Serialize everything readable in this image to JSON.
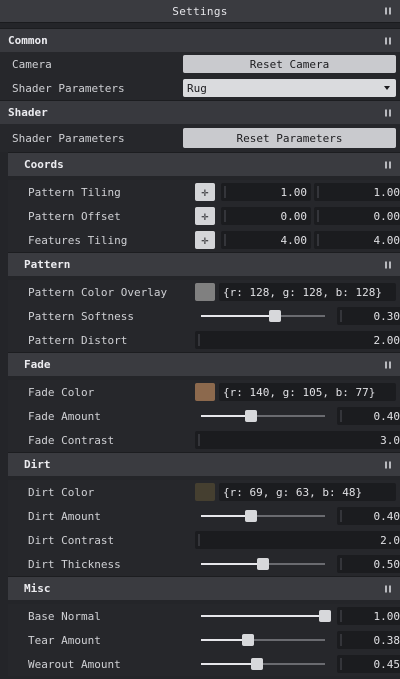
{
  "title": "Settings",
  "common": {
    "header": "Common",
    "camera_label": "Camera",
    "camera_button": "Reset Camera",
    "shader_params_label": "Shader Parameters",
    "shader_params_value": "Rug"
  },
  "shader": {
    "header": "Shader",
    "params_label": "Shader Parameters",
    "params_button": "Reset Parameters"
  },
  "coords": {
    "header": "Coords",
    "rows": [
      {
        "label": "Pattern Tiling",
        "x": "1.00",
        "y": "1.00"
      },
      {
        "label": "Pattern Offset",
        "x": "0.00",
        "y": "0.00"
      },
      {
        "label": "Features Tiling",
        "x": "4.00",
        "y": "4.00"
      }
    ]
  },
  "pattern": {
    "header": "Pattern",
    "color_label": "Pattern Color Overlay",
    "color_text": "{r: 128, g: 128, b: 128}",
    "color_hex": "#808080",
    "softness_label": "Pattern Softness",
    "softness_value": "0.30",
    "softness_level": 0.6,
    "distort_label": "Pattern Distort",
    "distort_value": "2.00"
  },
  "fade": {
    "header": "Fade",
    "color_label": "Fade Color",
    "color_text": "{r: 140, g: 105, b: 77}",
    "color_hex": "#8c694d",
    "amount_label": "Fade Amount",
    "amount_value": "0.40",
    "amount_level": 0.4,
    "contrast_label": "Fade Contrast",
    "contrast_value": "3.0"
  },
  "dirt": {
    "header": "Dirt",
    "color_label": "Dirt Color",
    "color_text": "{r: 69, g: 63, b: 48}",
    "color_hex": "#453f30",
    "amount_label": "Dirt Amount",
    "amount_value": "0.40",
    "amount_level": 0.4,
    "contrast_label": "Dirt Contrast",
    "contrast_value": "2.0",
    "thickness_label": "Dirt Thickness",
    "thickness_value": "0.50",
    "thickness_level": 0.5
  },
  "misc": {
    "header": "Misc",
    "base_normal_label": "Base Normal",
    "base_normal_value": "1.00",
    "base_normal_level": 1.0,
    "tear_label": "Tear Amount",
    "tear_value": "0.38",
    "tear_level": 0.38,
    "wearout_label": "Wearout Amount",
    "wearout_value": "0.45",
    "wearout_level": 0.45
  }
}
